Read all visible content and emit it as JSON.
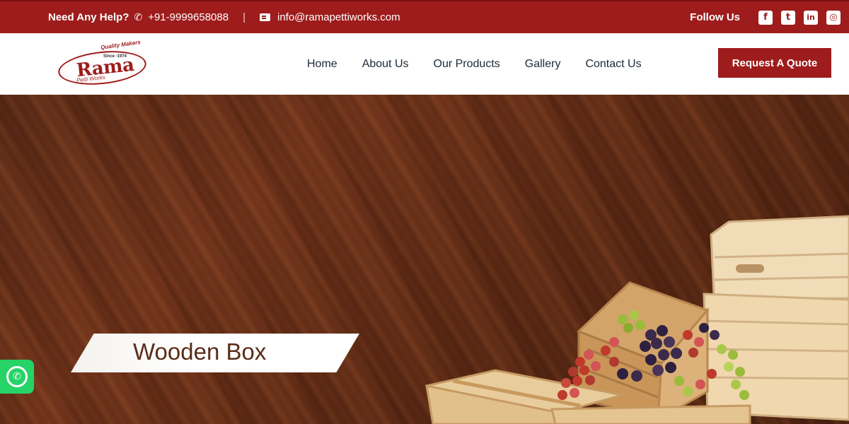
{
  "topbar": {
    "help_label": "Need Any Help?",
    "phone_icon": "phone-icon",
    "phone": "+91-9999658088",
    "separator": "|",
    "mail_icon": "mail-icon",
    "email": "info@ramapettiworks.com",
    "follow_label": "Follow Us",
    "social": [
      {
        "icon": "facebook-icon",
        "glyph": "f"
      },
      {
        "icon": "twitter-icon",
        "glyph": "t"
      },
      {
        "icon": "linkedin-icon",
        "glyph": "in"
      },
      {
        "icon": "instagram-icon",
        "glyph": "◎"
      }
    ]
  },
  "logo": {
    "tagline": "Quality Makers",
    "since": "Since -1974",
    "name": "Rama",
    "sub": "Petti Works"
  },
  "nav": {
    "items": [
      "Home",
      "About Us",
      "Our Products",
      "Gallery",
      "Contact Us"
    ],
    "quote_button": "Request A Quote"
  },
  "hero": {
    "banner_title": "Wooden Box"
  },
  "whatsapp": {
    "icon": "whatsapp-icon",
    "glyph": "✆"
  },
  "colors": {
    "brand": "#9e1c1c",
    "hero_wood": "#5a2a16",
    "whatsapp": "#25d366"
  }
}
